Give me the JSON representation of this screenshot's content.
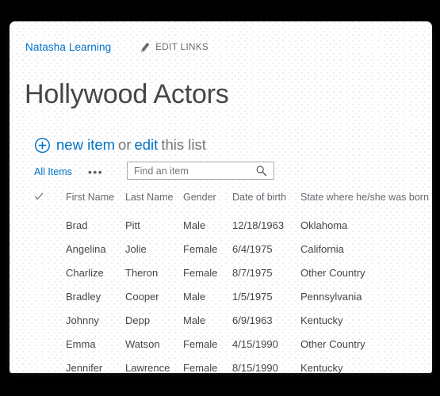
{
  "breadcrumb": {
    "site_label": "Natasha Learning",
    "edit_links_label": "EDIT LINKS",
    "pencil_icon": "pencil-icon"
  },
  "page": {
    "title": "Hollywood Actors"
  },
  "commands": {
    "plus_icon": "plus-circle-icon",
    "new_item_label": "new item",
    "or_label": "or",
    "edit_label": "edit",
    "this_list_label": "this list"
  },
  "toolbar": {
    "view_label": "All Items",
    "ellipsis_label": "•••"
  },
  "search": {
    "placeholder": "Find an item",
    "value": "",
    "icon": "search-icon"
  },
  "table": {
    "select_all_icon": "checkmark-icon",
    "columns": [
      "First Name",
      "Last Name",
      "Gender",
      "Date of birth",
      "State where he/she was born"
    ],
    "rows": [
      {
        "first_name": "Brad",
        "last_name": "Pitt",
        "gender": "Male",
        "dob": "12/18/1963",
        "state": "Oklahoma"
      },
      {
        "first_name": "Angelina",
        "last_name": "Jolie",
        "gender": "Female",
        "dob": "6/4/1975",
        "state": "California"
      },
      {
        "first_name": "Charlize",
        "last_name": "Theron",
        "gender": "Female",
        "dob": "8/7/1975",
        "state": "Other Country"
      },
      {
        "first_name": "Bradley",
        "last_name": "Cooper",
        "gender": "Male",
        "dob": "1/5/1975",
        "state": "Pennsylvania"
      },
      {
        "first_name": "Johnny",
        "last_name": "Depp",
        "gender": "Male",
        "dob": "6/9/1963",
        "state": "Kentucky"
      },
      {
        "first_name": "Emma",
        "last_name": "Watson",
        "gender": "Female",
        "dob": "4/15/1990",
        "state": "Other Country"
      },
      {
        "first_name": "Jennifer",
        "last_name": "Lawrence",
        "gender": "Female",
        "dob": "8/15/1990",
        "state": "Kentucky"
      }
    ]
  },
  "colors": {
    "link": "#0072c6",
    "text": "#444648",
    "muted": "#666a6e",
    "card_bg": "#ffffff",
    "page_bg": "#000000",
    "border": "#ababab"
  }
}
